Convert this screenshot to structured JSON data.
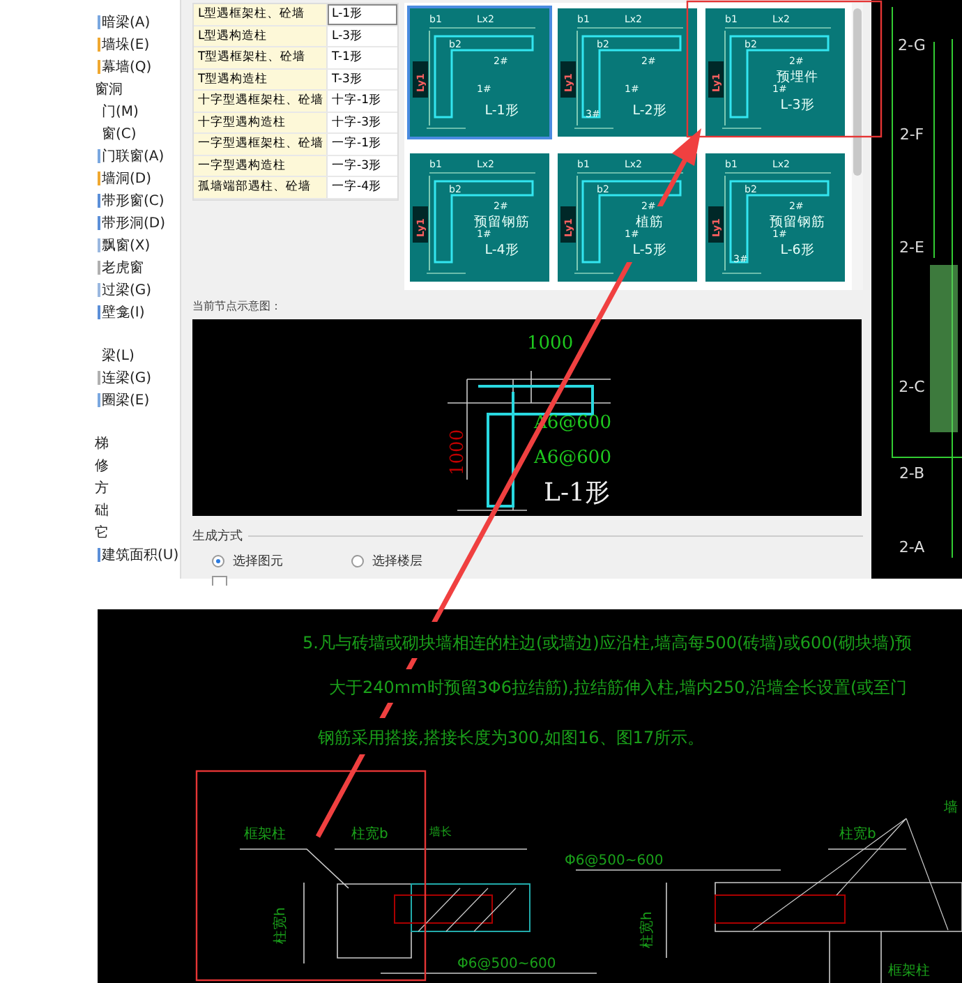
{
  "sidebar": {
    "groups": [
      {
        "items": [
          {
            "label": "暗梁(A)",
            "kind": "item",
            "color": "#7aa7e0"
          },
          {
            "label": "墙垛(E)",
            "kind": "item",
            "color": "#f0a830"
          },
          {
            "label": "幕墙(Q)",
            "kind": "item",
            "color": "#f0a830"
          },
          {
            "label": "窗洞",
            "kind": "heading"
          },
          {
            "label": "门(M)",
            "kind": "item"
          },
          {
            "label": "窗(C)",
            "kind": "item"
          },
          {
            "label": "门联窗(A)",
            "kind": "item",
            "color": "#7aa7e0"
          },
          {
            "label": "墙洞(D)",
            "kind": "item",
            "color": "#f0a830"
          },
          {
            "label": "带形窗(C)",
            "kind": "item",
            "color": "#5b8fd8"
          },
          {
            "label": "带形洞(D)",
            "kind": "item",
            "color": "#5b8fd8"
          },
          {
            "label": "飘窗(X)",
            "kind": "item",
            "color": "#9ab8e0"
          },
          {
            "label": "老虎窗",
            "kind": "item",
            "color": "#b0b0b0"
          },
          {
            "label": "过梁(G)",
            "kind": "item",
            "color": "#9ab8e0"
          },
          {
            "label": "壁龛(I)",
            "kind": "item",
            "color": "#5b8fd8"
          }
        ]
      },
      {
        "items": [
          {
            "label": "梁(L)",
            "kind": "item"
          },
          {
            "label": "连梁(G)",
            "kind": "item",
            "color": "#b0b0b0"
          },
          {
            "label": "圈梁(E)",
            "kind": "item",
            "color": "#7aa7e0"
          }
        ]
      },
      {
        "items": [
          {
            "label": "梯",
            "kind": "heading"
          },
          {
            "label": "修",
            "kind": "heading"
          },
          {
            "label": "方",
            "kind": "heading"
          },
          {
            "label": "础",
            "kind": "heading"
          },
          {
            "label": "它",
            "kind": "heading"
          },
          {
            "label": "建筑面积(U)",
            "kind": "item",
            "color": "#5b8fd8"
          }
        ]
      }
    ]
  },
  "node_table": {
    "rows": [
      {
        "name": "L型遇框架柱、砼墙",
        "shape": "L-1形",
        "selected": true
      },
      {
        "name": "L型遇构造柱",
        "shape": "L-3形",
        "selected": false
      },
      {
        "name": "T型遇框架柱、砼墙",
        "shape": "T-1形",
        "selected": false
      },
      {
        "name": "T型遇构造柱",
        "shape": "T-3形",
        "selected": false
      },
      {
        "name": "十字型遇框架柱、砼墙",
        "shape": "十字-1形",
        "selected": false
      },
      {
        "name": "十字型遇构造柱",
        "shape": "十字-3形",
        "selected": false
      },
      {
        "name": "一字型遇框架柱、砼墙",
        "shape": "一字-1形",
        "selected": false
      },
      {
        "name": "一字型遇构造柱",
        "shape": "一字-3形",
        "selected": false
      },
      {
        "name": "孤墙端部遇柱、砼墙",
        "shape": "一字-4形",
        "selected": false
      }
    ]
  },
  "thumbnails": [
    {
      "label": "L-1形",
      "marks": [
        "b1",
        "Lx2",
        "b2",
        "2#",
        "1#"
      ],
      "side_dim": "Ly1",
      "selected": true
    },
    {
      "label": "L-2形",
      "marks": [
        "b1",
        "Lx2",
        "b2",
        "2#",
        "1#",
        "3#"
      ],
      "side_dim": "Ly1",
      "selected": false
    },
    {
      "label": "L-3形",
      "caption": "预埋件",
      "marks": [
        "b1",
        "Lx2",
        "b2",
        "2#",
        "1#"
      ],
      "side_dim": "Ly1",
      "selected": false
    },
    {
      "label": "L-4形",
      "caption": "预留钢筋",
      "marks": [
        "b1",
        "Lx2",
        "b2",
        "2#",
        "1#"
      ],
      "side_dim": "Ly1",
      "selected": false
    },
    {
      "label": "L-5形",
      "caption": "植筋",
      "marks": [
        "b1",
        "Lx2",
        "b2",
        "2#",
        "1#"
      ],
      "side_dim": "Ly1",
      "selected": false
    },
    {
      "label": "L-6形",
      "caption": "预留钢筋",
      "marks": [
        "b1",
        "Lx2",
        "b2",
        "2#",
        "1#",
        "3#"
      ],
      "side_dim": "Ly1",
      "selected": false
    }
  ],
  "preview": {
    "title": "当前节点示意图：",
    "top_dim": "1000",
    "side_dim": "1000",
    "notes": [
      "A6@600",
      "A6@600"
    ],
    "label": "L-1形"
  },
  "generation": {
    "title": "生成方式",
    "options": [
      {
        "label": "选择图元",
        "selected": true
      },
      {
        "label": "选择楼层",
        "selected": false
      }
    ],
    "checkbox": {
      "checked": false
    }
  },
  "grid_axes": [
    "2-G",
    "2-F",
    "2-E",
    "2-C",
    "2-B",
    "2-A"
  ],
  "drawing": {
    "notes": [
      "5.凡与砖墙或砌块墙相连的柱边(或墙边)应沿柱,墙高每500(砖墙)或600(砌块墙)预",
      "大于240mm时预留3Φ6拉结筋),拉结筋伸入柱,墙内250,沿墙全长设置(或至门",
      "钢筋采用搭接,搭接长度为300,如图16、图17所示。"
    ],
    "left": {
      "column": "框架柱",
      "width": "柱宽b",
      "wall": "墙长",
      "height": "柱宽h",
      "rebar": [
        "Φ6@500~600"
      ]
    },
    "right": {
      "width": "柱宽b",
      "height": "柱宽h",
      "rebar": "Φ6@500~600",
      "column": "框架柱",
      "wall": "墙"
    }
  }
}
